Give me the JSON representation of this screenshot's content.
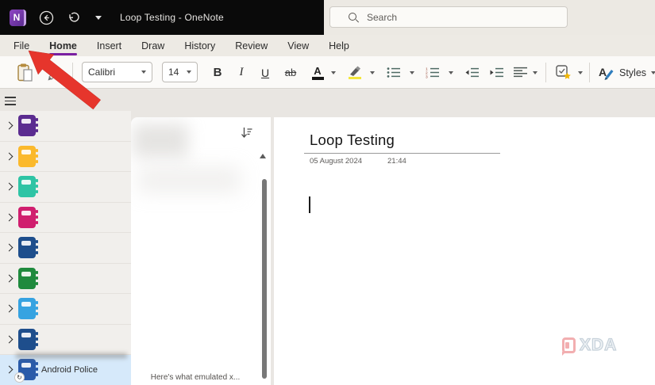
{
  "titlebar": {
    "app_initial": "N",
    "title": "Loop Testing  -  OneNote",
    "search_placeholder": "Search"
  },
  "menubar": {
    "items": [
      "File",
      "Home",
      "Insert",
      "Draw",
      "History",
      "Review",
      "View",
      "Help"
    ],
    "active_item": "Home"
  },
  "ribbon": {
    "font_name": "Calibri",
    "font_size": "14",
    "bold_label": "B",
    "italic_label": "I",
    "underline_label": "U",
    "strikethrough_label": "ab",
    "font_color_label": "A",
    "styles_label": "Styles"
  },
  "sidebar": {
    "notebooks": [
      {
        "color": "#5b2c90",
        "selected": false,
        "badge": false,
        "label": ""
      },
      {
        "color": "#fbb92c",
        "selected": false,
        "badge": false,
        "label": ""
      },
      {
        "color": "#2ec4a5",
        "selected": false,
        "badge": false,
        "label": ""
      },
      {
        "color": "#d01e6e",
        "selected": false,
        "badge": false,
        "label": ""
      },
      {
        "color": "#1e4e8c",
        "selected": false,
        "badge": false,
        "label": ""
      },
      {
        "color": "#1f8a3d",
        "selected": false,
        "badge": false,
        "label": ""
      },
      {
        "color": "#36a3e1",
        "selected": false,
        "badge": false,
        "label": ""
      },
      {
        "color": "#1e4e8c",
        "selected": false,
        "badge": false,
        "label": ""
      },
      {
        "color": "#2a5ba9",
        "selected": true,
        "badge": true,
        "label": "Android Police"
      }
    ]
  },
  "page_list": {
    "bottom_page_title": "Here's what emulated x..."
  },
  "page": {
    "title": "Loop Testing",
    "date": "05 August 2024",
    "time": "21:44"
  },
  "watermark": {
    "text": "XDA"
  },
  "colors": {
    "accent_purple": "#7a1fa2",
    "arrow_red": "#e6352c",
    "highlight_yellow": "#f3e73c",
    "titlebar_dark": "#0a0a0a",
    "chrome_beige": "#ece9e3"
  }
}
